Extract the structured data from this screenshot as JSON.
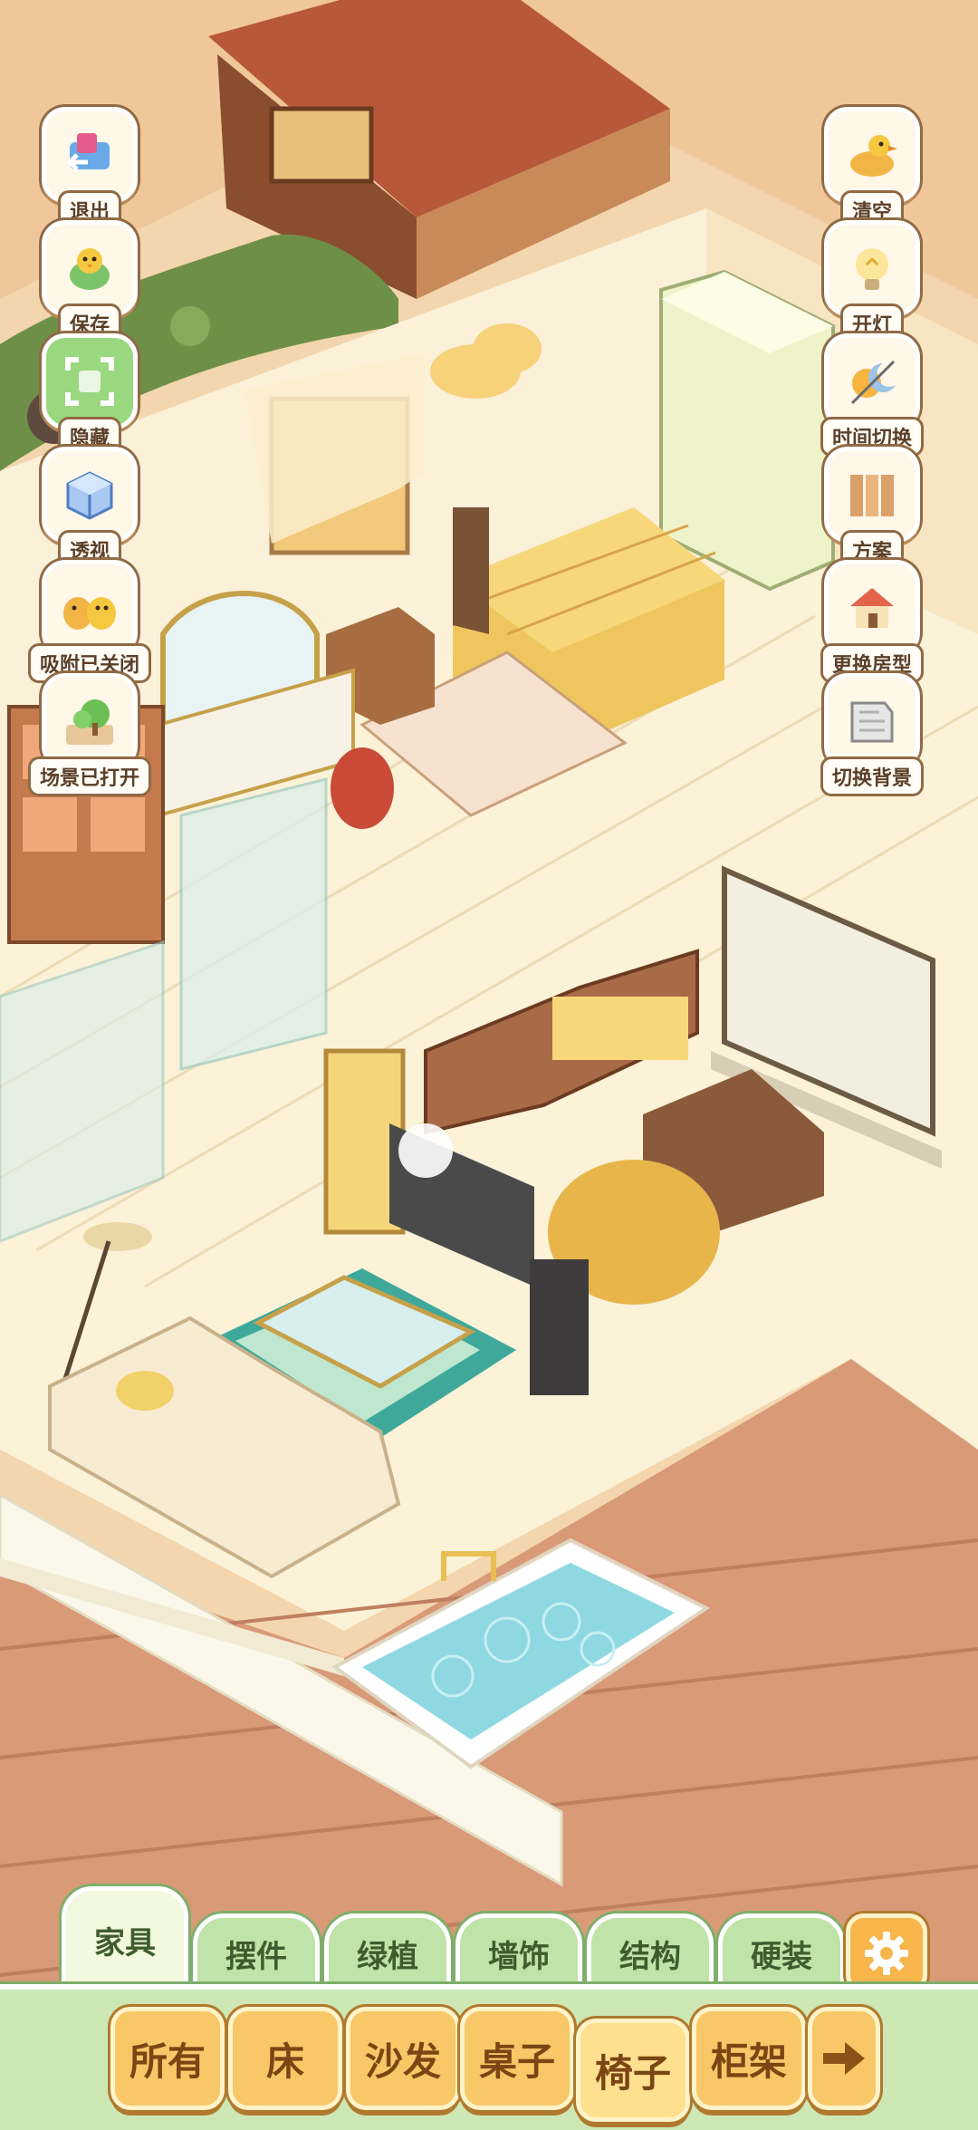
{
  "left_buttons": [
    {
      "label": "退出",
      "icon": "exit-door-icon"
    },
    {
      "label": "保存",
      "icon": "save-chick-icon"
    },
    {
      "label": "隐藏",
      "icon": "hide-frame-icon"
    },
    {
      "label": "透视",
      "icon": "perspective-cube-icon"
    },
    {
      "label": "吸附已关闭",
      "icon": "snap-chicks-icon"
    },
    {
      "label": "场景已打开",
      "icon": "scene-tree-icon"
    }
  ],
  "right_buttons": [
    {
      "label": "清空",
      "icon": "clear-duck-icon"
    },
    {
      "label": "开灯",
      "icon": "light-bulb-icon"
    },
    {
      "label": "时间切换",
      "icon": "sun-moon-icon"
    },
    {
      "label": "方案",
      "icon": "plan-panels-icon"
    },
    {
      "label": "更换房型",
      "icon": "house-type-icon"
    },
    {
      "label": "切换背景",
      "icon": "background-icon"
    }
  ],
  "tabs": [
    {
      "label": "家具",
      "active": true
    },
    {
      "label": "摆件",
      "active": false
    },
    {
      "label": "绿植",
      "active": false
    },
    {
      "label": "墙饰",
      "active": false
    },
    {
      "label": "结构",
      "active": false
    },
    {
      "label": "硬装",
      "active": false
    }
  ],
  "categories": [
    {
      "label": "所有"
    },
    {
      "label": "床"
    },
    {
      "label": "沙发"
    },
    {
      "label": "桌子"
    },
    {
      "label": "椅子",
      "selected": true
    },
    {
      "label": "柜架"
    }
  ],
  "icons": {
    "settings": "gear-icon",
    "next": "arrow-right-icon"
  },
  "colors": {
    "grass_tab": "#bfe3a8",
    "category_button": "#f7c768",
    "floor": "#fbf2d8",
    "deck": "#d99a78"
  }
}
